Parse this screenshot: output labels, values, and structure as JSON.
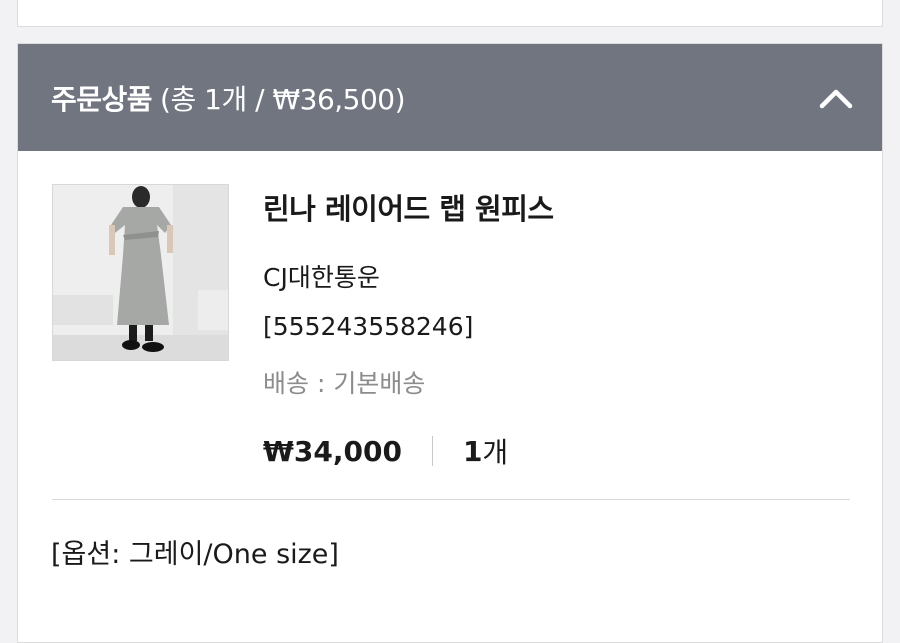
{
  "order_section": {
    "title": "주문상품",
    "summary": "(총 1개 / ₩36,500)",
    "collapse_icon": "chevron-up-icon"
  },
  "product": {
    "name": "린나 레이어드 랩 원피스",
    "courier": "CJ대한통운",
    "tracking_number": "[555243558246]",
    "shipping": "배송 : 기본배송",
    "price": "₩34,000",
    "quantity": "1",
    "quantity_unit": "개",
    "option": "[옵션: 그레이/One size]",
    "image_icon": "dress-photo"
  },
  "colors": {
    "header_bg": "#707580",
    "header_text": "#ffffff",
    "muted_text": "#8c8c8c"
  }
}
